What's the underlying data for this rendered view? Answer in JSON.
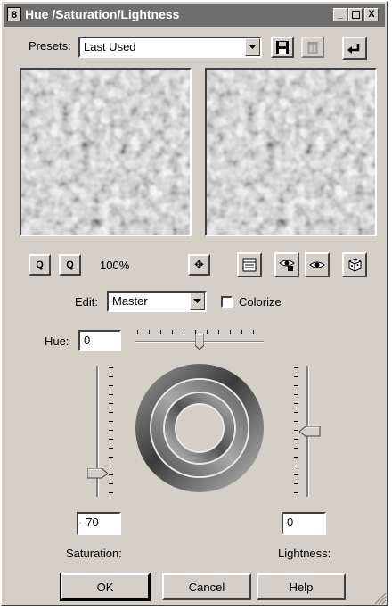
{
  "window": {
    "title": "Hue /Saturation/Lightness",
    "title_icon": "8",
    "minimize_glyph": "_",
    "maximize_glyph": "□",
    "close_glyph": "X"
  },
  "presets": {
    "label": "Presets:",
    "value": "Last Used",
    "icons": [
      "save-preset-icon",
      "delete-preset-icon",
      "reset-icon"
    ]
  },
  "zoom": {
    "zoom_out_glyph": "Q",
    "zoom_in_glyph": "Q",
    "level": "100%",
    "pan_glyph": "✥"
  },
  "edit": {
    "label": "Edit:",
    "value": "Master",
    "colorize_label": "Colorize",
    "colorize_checked": false
  },
  "hue": {
    "label": "Hue:",
    "value": "0",
    "slider_fraction": 0.5
  },
  "saturation": {
    "label": "Saturation:",
    "value": "-70",
    "slider_fraction": 0.15
  },
  "lightness": {
    "label": "Lightness:",
    "value": "0",
    "slider_fraction": 0.5
  },
  "buttons": {
    "ok": "OK",
    "cancel": "Cancel",
    "help": "Help"
  }
}
